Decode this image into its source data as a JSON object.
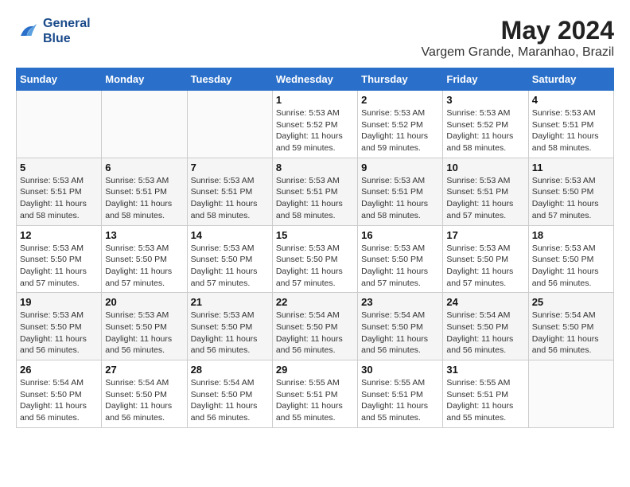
{
  "logo": {
    "line1": "General",
    "line2": "Blue"
  },
  "title": {
    "month_year": "May 2024",
    "location": "Vargem Grande, Maranhao, Brazil"
  },
  "days_of_week": [
    "Sunday",
    "Monday",
    "Tuesday",
    "Wednesday",
    "Thursday",
    "Friday",
    "Saturday"
  ],
  "weeks": [
    [
      {
        "day": "",
        "sunrise": "",
        "sunset": "",
        "daylight": ""
      },
      {
        "day": "",
        "sunrise": "",
        "sunset": "",
        "daylight": ""
      },
      {
        "day": "",
        "sunrise": "",
        "sunset": "",
        "daylight": ""
      },
      {
        "day": "1",
        "sunrise": "Sunrise: 5:53 AM",
        "sunset": "Sunset: 5:52 PM",
        "daylight": "Daylight: 11 hours and 59 minutes."
      },
      {
        "day": "2",
        "sunrise": "Sunrise: 5:53 AM",
        "sunset": "Sunset: 5:52 PM",
        "daylight": "Daylight: 11 hours and 59 minutes."
      },
      {
        "day": "3",
        "sunrise": "Sunrise: 5:53 AM",
        "sunset": "Sunset: 5:52 PM",
        "daylight": "Daylight: 11 hours and 58 minutes."
      },
      {
        "day": "4",
        "sunrise": "Sunrise: 5:53 AM",
        "sunset": "Sunset: 5:51 PM",
        "daylight": "Daylight: 11 hours and 58 minutes."
      }
    ],
    [
      {
        "day": "5",
        "sunrise": "Sunrise: 5:53 AM",
        "sunset": "Sunset: 5:51 PM",
        "daylight": "Daylight: 11 hours and 58 minutes."
      },
      {
        "day": "6",
        "sunrise": "Sunrise: 5:53 AM",
        "sunset": "Sunset: 5:51 PM",
        "daylight": "Daylight: 11 hours and 58 minutes."
      },
      {
        "day": "7",
        "sunrise": "Sunrise: 5:53 AM",
        "sunset": "Sunset: 5:51 PM",
        "daylight": "Daylight: 11 hours and 58 minutes."
      },
      {
        "day": "8",
        "sunrise": "Sunrise: 5:53 AM",
        "sunset": "Sunset: 5:51 PM",
        "daylight": "Daylight: 11 hours and 58 minutes."
      },
      {
        "day": "9",
        "sunrise": "Sunrise: 5:53 AM",
        "sunset": "Sunset: 5:51 PM",
        "daylight": "Daylight: 11 hours and 58 minutes."
      },
      {
        "day": "10",
        "sunrise": "Sunrise: 5:53 AM",
        "sunset": "Sunset: 5:51 PM",
        "daylight": "Daylight: 11 hours and 57 minutes."
      },
      {
        "day": "11",
        "sunrise": "Sunrise: 5:53 AM",
        "sunset": "Sunset: 5:50 PM",
        "daylight": "Daylight: 11 hours and 57 minutes."
      }
    ],
    [
      {
        "day": "12",
        "sunrise": "Sunrise: 5:53 AM",
        "sunset": "Sunset: 5:50 PM",
        "daylight": "Daylight: 11 hours and 57 minutes."
      },
      {
        "day": "13",
        "sunrise": "Sunrise: 5:53 AM",
        "sunset": "Sunset: 5:50 PM",
        "daylight": "Daylight: 11 hours and 57 minutes."
      },
      {
        "day": "14",
        "sunrise": "Sunrise: 5:53 AM",
        "sunset": "Sunset: 5:50 PM",
        "daylight": "Daylight: 11 hours and 57 minutes."
      },
      {
        "day": "15",
        "sunrise": "Sunrise: 5:53 AM",
        "sunset": "Sunset: 5:50 PM",
        "daylight": "Daylight: 11 hours and 57 minutes."
      },
      {
        "day": "16",
        "sunrise": "Sunrise: 5:53 AM",
        "sunset": "Sunset: 5:50 PM",
        "daylight": "Daylight: 11 hours and 57 minutes."
      },
      {
        "day": "17",
        "sunrise": "Sunrise: 5:53 AM",
        "sunset": "Sunset: 5:50 PM",
        "daylight": "Daylight: 11 hours and 57 minutes."
      },
      {
        "day": "18",
        "sunrise": "Sunrise: 5:53 AM",
        "sunset": "Sunset: 5:50 PM",
        "daylight": "Daylight: 11 hours and 56 minutes."
      }
    ],
    [
      {
        "day": "19",
        "sunrise": "Sunrise: 5:53 AM",
        "sunset": "Sunset: 5:50 PM",
        "daylight": "Daylight: 11 hours and 56 minutes."
      },
      {
        "day": "20",
        "sunrise": "Sunrise: 5:53 AM",
        "sunset": "Sunset: 5:50 PM",
        "daylight": "Daylight: 11 hours and 56 minutes."
      },
      {
        "day": "21",
        "sunrise": "Sunrise: 5:53 AM",
        "sunset": "Sunset: 5:50 PM",
        "daylight": "Daylight: 11 hours and 56 minutes."
      },
      {
        "day": "22",
        "sunrise": "Sunrise: 5:54 AM",
        "sunset": "Sunset: 5:50 PM",
        "daylight": "Daylight: 11 hours and 56 minutes."
      },
      {
        "day": "23",
        "sunrise": "Sunrise: 5:54 AM",
        "sunset": "Sunset: 5:50 PM",
        "daylight": "Daylight: 11 hours and 56 minutes."
      },
      {
        "day": "24",
        "sunrise": "Sunrise: 5:54 AM",
        "sunset": "Sunset: 5:50 PM",
        "daylight": "Daylight: 11 hours and 56 minutes."
      },
      {
        "day": "25",
        "sunrise": "Sunrise: 5:54 AM",
        "sunset": "Sunset: 5:50 PM",
        "daylight": "Daylight: 11 hours and 56 minutes."
      }
    ],
    [
      {
        "day": "26",
        "sunrise": "Sunrise: 5:54 AM",
        "sunset": "Sunset: 5:50 PM",
        "daylight": "Daylight: 11 hours and 56 minutes."
      },
      {
        "day": "27",
        "sunrise": "Sunrise: 5:54 AM",
        "sunset": "Sunset: 5:50 PM",
        "daylight": "Daylight: 11 hours and 56 minutes."
      },
      {
        "day": "28",
        "sunrise": "Sunrise: 5:54 AM",
        "sunset": "Sunset: 5:50 PM",
        "daylight": "Daylight: 11 hours and 56 minutes."
      },
      {
        "day": "29",
        "sunrise": "Sunrise: 5:55 AM",
        "sunset": "Sunset: 5:51 PM",
        "daylight": "Daylight: 11 hours and 55 minutes."
      },
      {
        "day": "30",
        "sunrise": "Sunrise: 5:55 AM",
        "sunset": "Sunset: 5:51 PM",
        "daylight": "Daylight: 11 hours and 55 minutes."
      },
      {
        "day": "31",
        "sunrise": "Sunrise: 5:55 AM",
        "sunset": "Sunset: 5:51 PM",
        "daylight": "Daylight: 11 hours and 55 minutes."
      },
      {
        "day": "",
        "sunrise": "",
        "sunset": "",
        "daylight": ""
      }
    ]
  ]
}
